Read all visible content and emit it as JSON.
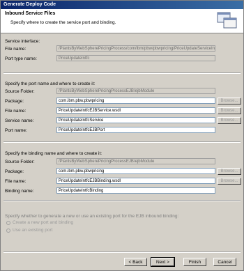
{
  "window": {
    "title": "Generate Deploy Code"
  },
  "banner": {
    "title": "Inbound Service Files",
    "description": "Specify where to create the service port and binding."
  },
  "service_interface": {
    "section_label": "Service interface:",
    "file_name_label": "File name:",
    "file_name_value": "/PlantsByWebSpherePricingProcess/com/ibm/pbw/pbwpricing/PriceUpdateServiceInterface.wsdl",
    "port_type_label": "Port type name:",
    "port_type_value": "PriceUpdateIntfc"
  },
  "port": {
    "section_label": "Specify the port name and where to create it:",
    "source_folder_label": "Source Folder:",
    "source_folder_value": "/PlantsByWebSpherePricingProcessEJB/ejbModule",
    "package_label": "Package:",
    "package_value": "com.ibm.pbw.pbwpricing",
    "file_name_label": "File name:",
    "file_name_value": "PriceUpdateIntfcEJBService.wsdl",
    "service_name_label": "Service name:",
    "service_name_value": "PriceUpdateIntfcService",
    "port_name_label": "Port name:",
    "port_name_value": "PriceUpdateIntfcEJBPort"
  },
  "binding": {
    "section_label": "Specify the binding name and where to create it:",
    "source_folder_label": "Source Folder:",
    "source_folder_value": "/PlantsByWebSpherePricingProcessEJB/ejbModule",
    "package_label": "Package:",
    "package_value": "com.ibm.pbw.pbwpricing",
    "file_name_label": "File name:",
    "file_name_value": "PriceUpdateIntfcEJBBinding.wsdl",
    "binding_name_label": "Binding name:",
    "binding_name_value": "PriceUpdateIntfcBinding"
  },
  "browse_label": "Browse...",
  "generate": {
    "question": "Specify whether to generate a new or use an existing port for the EJB inbound binding:",
    "option_new": "Create a new port and binding",
    "option_existing": "Use an existing port"
  },
  "footer": {
    "back": "< Back",
    "next": "Next >",
    "finish": "Finish",
    "cancel": "Cancel"
  }
}
